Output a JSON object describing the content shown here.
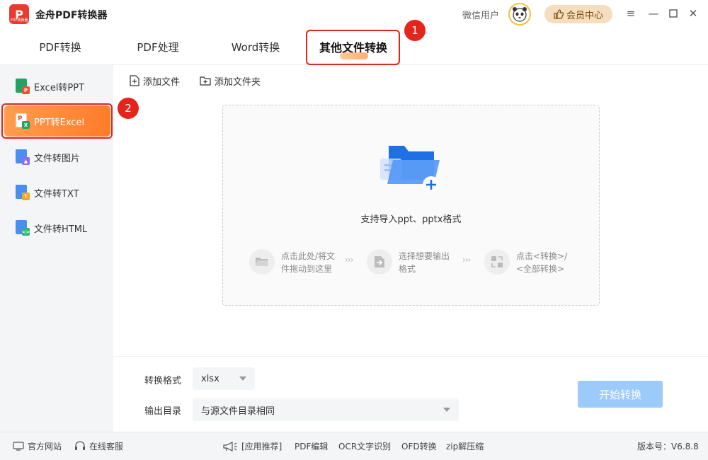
{
  "app": {
    "title": "金舟PDF转换器",
    "logo_text": "P",
    "logo_sub": "PDF转换器"
  },
  "header": {
    "user_label": "微信用户",
    "vip_label": "会员中心"
  },
  "tabs": [
    {
      "label": "PDF转换"
    },
    {
      "label": "PDF处理"
    },
    {
      "label": "Word转换"
    },
    {
      "label": "其他文件转换"
    }
  ],
  "annotations": {
    "badge1": "1",
    "badge2": "2"
  },
  "sidebar": {
    "items": [
      {
        "label": "Excel转PPT",
        "icon": "excel-to-ppt-icon"
      },
      {
        "label": "PPT转Excel",
        "icon": "ppt-to-excel-icon"
      },
      {
        "label": "文件转图片",
        "icon": "file-to-image-icon"
      },
      {
        "label": "文件转TXT",
        "icon": "file-to-txt-icon"
      },
      {
        "label": "文件转HTML",
        "icon": "file-to-html-icon"
      }
    ]
  },
  "toolbar": {
    "add_file": "添加文件",
    "add_folder": "添加文件夹"
  },
  "dropzone": {
    "hint": "支持导入ppt、pptx格式",
    "steps": [
      {
        "line1": "点击此处/将文",
        "line2": "件拖动到这里"
      },
      {
        "line1": "选择想要输出",
        "line2": "格式"
      },
      {
        "line1": "点击<转换>/",
        "line2": "<全部转换>"
      }
    ],
    "arrow": "›››"
  },
  "settings": {
    "format_label": "转换格式",
    "format_value": "xlsx",
    "output_label": "输出目录",
    "output_value": "与源文件目录相同",
    "start_button": "开始转换"
  },
  "footer": {
    "website": "官方网站",
    "support": "在线客服",
    "recommend": "[应用推荐]",
    "links": [
      "PDF编辑",
      "OCR文字识别",
      "OFD转换",
      "zip解压缩"
    ],
    "version": "版本号：V6.8.8"
  },
  "colors": {
    "accent": "#ff7c2a",
    "highlight": "#e3251c",
    "start_button": "#9ccaf9"
  }
}
